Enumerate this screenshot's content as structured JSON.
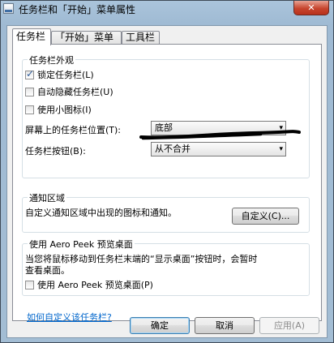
{
  "window": {
    "title": "任务栏和「开始」菜单属性",
    "close_glyph": "✕"
  },
  "tabs": [
    {
      "label": "任务栏",
      "active": true
    },
    {
      "label": "「开始」菜单",
      "active": false
    },
    {
      "label": "工具栏",
      "active": false
    }
  ],
  "appearance": {
    "legend": "任务栏外观",
    "checkboxes": [
      {
        "label": "锁定任务栏(L)",
        "checked": true
      },
      {
        "label": "自动隐藏任务栏(U)",
        "checked": false
      },
      {
        "label": "使用小图标(I)",
        "checked": false
      }
    ],
    "location_label": "屏幕上的任务栏位置(T):",
    "location_value": "底部",
    "buttons_label": "任务栏按钮(B):",
    "buttons_value": "从不合并"
  },
  "notification": {
    "legend": "通知区域",
    "description": "自定义通知区域中出现的图标和通知。",
    "customize_button": "自定义(C)..."
  },
  "aeropeek": {
    "legend": "使用 Aero Peek 预览桌面",
    "description_line1": "当您将鼠标移动到任务栏末端的“显示桌面”按钮时，会暂时",
    "description_line2": "查看桌面。",
    "checkbox_label": "使用 Aero Peek 预览桌面(P)",
    "checkbox_checked": false
  },
  "help_link": "如何自定义该任务栏?",
  "footer": {
    "ok": "确定",
    "cancel": "取消",
    "apply": "应用(A)"
  },
  "colors": {
    "link": "#0066cc",
    "check": "#2c5b9a"
  },
  "icons": {
    "dropdown": "▾",
    "check": "✓"
  }
}
